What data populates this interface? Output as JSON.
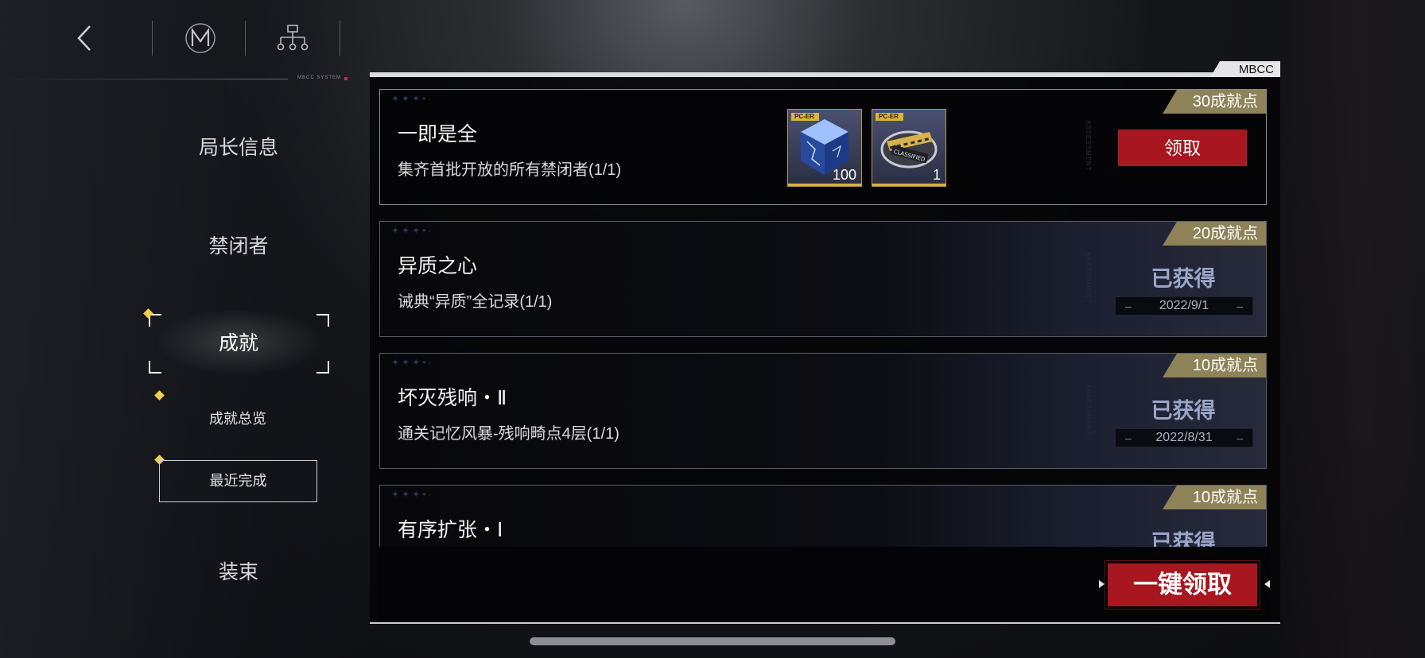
{
  "window": {
    "brand_tab": "MBCC",
    "system_label": "MBCC SYSTEM"
  },
  "topbar": {
    "back_icon": "chevron-left-icon",
    "logo_icon": "mbcc-m-logo-icon",
    "tree_icon": "hierarchy-tree-icon"
  },
  "sidebar": {
    "items": [
      {
        "label": "局长信息"
      },
      {
        "label": "禁闭者"
      },
      {
        "label": "成就"
      },
      {
        "label": "装束"
      }
    ],
    "subitems": [
      {
        "label": "成就总览"
      },
      {
        "label": "最近完成"
      }
    ],
    "selected": "成就",
    "selected_sub": "最近完成"
  },
  "achievements": [
    {
      "title": "一即是全",
      "desc": "集齐首批开放的所有禁闭者(1/1)",
      "points": "30成就点",
      "state": "claimable",
      "claim_label": "领取",
      "rewards": [
        {
          "icon": "blue-crystal-cube-icon",
          "tag": "PC-ER",
          "qty": "100"
        },
        {
          "icon": "classified-badge-icon",
          "tag": "PC-ER",
          "qty": "1",
          "badge_text": "CLASSIFIED"
        }
      ]
    },
    {
      "title": "异质之心",
      "desc": "诫典“异质”全记录(1/1)",
      "points": "20成就点",
      "state": "obtained",
      "obtained_label": "已获得",
      "date": "2022/9/1"
    },
    {
      "title": "坏灭残响・Ⅱ",
      "desc": "通关记忆风暴-残响畸点4层(1/1)",
      "points": "10成就点",
      "state": "obtained",
      "obtained_label": "已获得",
      "date": "2022/8/31"
    },
    {
      "title": "有序扩张・Ⅰ",
      "desc": "",
      "points": "10成就点",
      "state": "obtained",
      "obtained_label": "已获得",
      "date": ""
    }
  ],
  "footer": {
    "claim_all_label": "一键领取"
  },
  "colors": {
    "accent_red": "#a8161f",
    "gold": "#8e8258",
    "reward_border": "#b59a3c",
    "obtained_text": "#9aa6c8"
  }
}
